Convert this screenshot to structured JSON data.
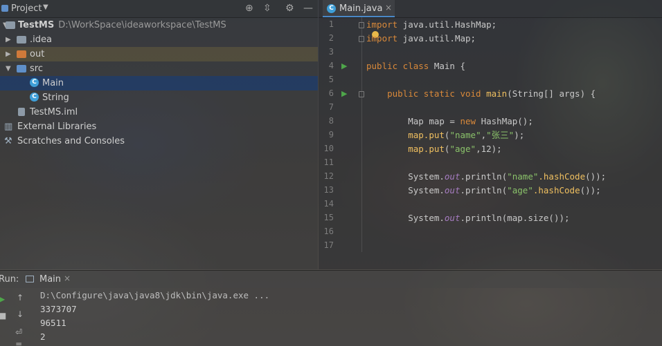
{
  "project_panel": {
    "title": "Project",
    "tree": [
      {
        "label": "TestMS",
        "path": "D:\\WorkSpace\\ideaworkspace\\TestMS"
      },
      {
        "label": ".idea"
      },
      {
        "label": "out"
      },
      {
        "label": "src"
      },
      {
        "label": "Main"
      },
      {
        "label": "String"
      },
      {
        "label": "TestMS.iml"
      },
      {
        "label": "External Libraries"
      },
      {
        "label": "Scratches and Consoles"
      }
    ]
  },
  "editor": {
    "tab": {
      "label": "Main.java"
    },
    "line_numbers": [
      "1",
      "2",
      "3",
      "4",
      "5",
      "6",
      "7",
      "8",
      "9",
      "10",
      "11",
      "12",
      "13",
      "14",
      "15",
      "16",
      "17"
    ],
    "code": {
      "l1": {
        "kw": "import",
        "rest": " java.util.HashMap;"
      },
      "l2": {
        "kw": "import",
        "rest": " java.util.Map;"
      },
      "l4": {
        "kw": "public class",
        "rest": " Main {"
      },
      "l6": {
        "kw": "public static void",
        "fn": "main",
        "rest": "(String[] args) {"
      },
      "l8": {
        "pre": "Map map = ",
        "kw": "new",
        "rest": " HashMap();"
      },
      "l9": {
        "fn": "map.put",
        "p1": "(",
        "s1": "\"name\"",
        "c": ",",
        "s2": "\"张三\"",
        "end": ");"
      },
      "l10": {
        "fn": "map.put",
        "p1": "(",
        "s1": "\"age\"",
        "end": ",12);"
      },
      "l12": {
        "pre": "System.",
        "it": "out",
        "mid": ".println(",
        "s1": "\"name\"",
        "fn": ".hashCode",
        "end": "());"
      },
      "l13": {
        "pre": "System.",
        "it": "out",
        "mid": ".println(",
        "s1": "\"age\"",
        "fn": ".hashCode",
        "end": "());"
      },
      "l15": {
        "pre": "System.",
        "it": "out",
        "mid": ".println(map.size());"
      }
    }
  },
  "run_panel": {
    "label": "Run:",
    "tab_label": "Main",
    "console": [
      "D:\\Configure\\java\\java8\\jdk\\bin\\java.exe ...",
      "3373707",
      "96511",
      "2"
    ]
  },
  "colors": {
    "keyword": "#d9893a",
    "string": "#8ac26a",
    "method": "#f0c060",
    "static_field": "#a57cc0",
    "selection": "#1e3c6e",
    "run_green": "#4ea64a"
  }
}
